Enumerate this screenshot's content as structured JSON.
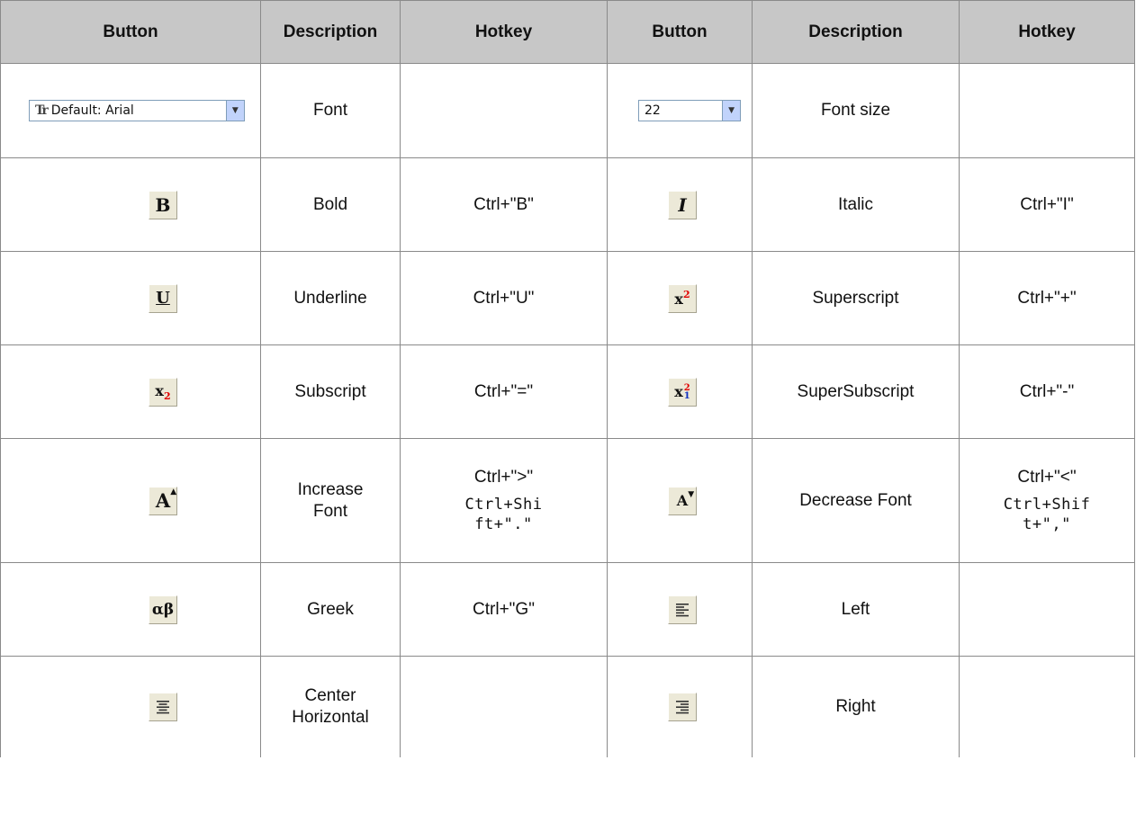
{
  "headers": [
    "Button",
    "Description",
    "Hotkey",
    "Button",
    "Description",
    "Hotkey"
  ],
  "rows": [
    {
      "left": {
        "desc": "Font",
        "hotkey": "",
        "hotkey_alt": "",
        "control_value": "Default: Arial"
      },
      "right": {
        "desc": "Font size",
        "hotkey": "",
        "hotkey_alt": "",
        "control_value": "22"
      }
    },
    {
      "left": {
        "desc": "Bold",
        "hotkey": "Ctrl+\"B\"",
        "hotkey_alt": "",
        "icon": "bold-icon"
      },
      "right": {
        "desc": "Italic",
        "hotkey": "Ctrl+\"I\"",
        "hotkey_alt": "",
        "icon": "italic-icon"
      }
    },
    {
      "left": {
        "desc": "Underline",
        "hotkey": "Ctrl+\"U\"",
        "hotkey_alt": "",
        "icon": "underline-icon"
      },
      "right": {
        "desc": "Superscript",
        "hotkey": "Ctrl+\"+\"",
        "hotkey_alt": "",
        "icon": "superscript-icon"
      }
    },
    {
      "left": {
        "desc": "Subscript",
        "hotkey": "Ctrl+\"=\"",
        "hotkey_alt": "",
        "icon": "subscript-icon"
      },
      "right": {
        "desc": "SuperSubscript",
        "hotkey": "Ctrl+\"-\"",
        "hotkey_alt": "",
        "icon": "supersubscript-icon"
      }
    },
    {
      "left": {
        "desc": "Increase Font",
        "hotkey": "Ctrl+\">\"",
        "hotkey_alt": "Ctrl+Shift+\".\"",
        "icon": "increase-font-icon"
      },
      "right": {
        "desc": "Decrease Font",
        "hotkey": "Ctrl+\"<\"",
        "hotkey_alt": "Ctrl+Shift+\",\"",
        "icon": "decrease-font-icon"
      }
    },
    {
      "left": {
        "desc": "Greek",
        "hotkey": "Ctrl+\"G\"",
        "hotkey_alt": "",
        "icon": "greek-icon"
      },
      "right": {
        "desc": "Left",
        "hotkey": "",
        "hotkey_alt": "",
        "icon": "align-left-icon"
      }
    },
    {
      "left": {
        "desc": "Center Horizontal",
        "hotkey": "",
        "hotkey_alt": "",
        "icon": "align-center-icon"
      },
      "right": {
        "desc": "Right",
        "hotkey": "",
        "hotkey_alt": "",
        "icon": "align-right-icon"
      }
    }
  ],
  "glyphs": {
    "bold": "B",
    "italic": "I",
    "underline": "U",
    "x": "x",
    "sup_digit": "2",
    "sub_digit": "2",
    "stack_top": "2",
    "stack_bottom": "1",
    "big_a": "A",
    "up_arrow": "▲",
    "down_arrow": "▼",
    "greek": "αβ",
    "tt": "Tr"
  },
  "colors": {
    "header_bg": "#c7c7c7",
    "button_face": "#ece9d8",
    "combo_border": "#7f9db9",
    "combo_arrow_bg": "#c1d3fb",
    "accent_red": "#e00000",
    "accent_blue": "#1030c0"
  }
}
